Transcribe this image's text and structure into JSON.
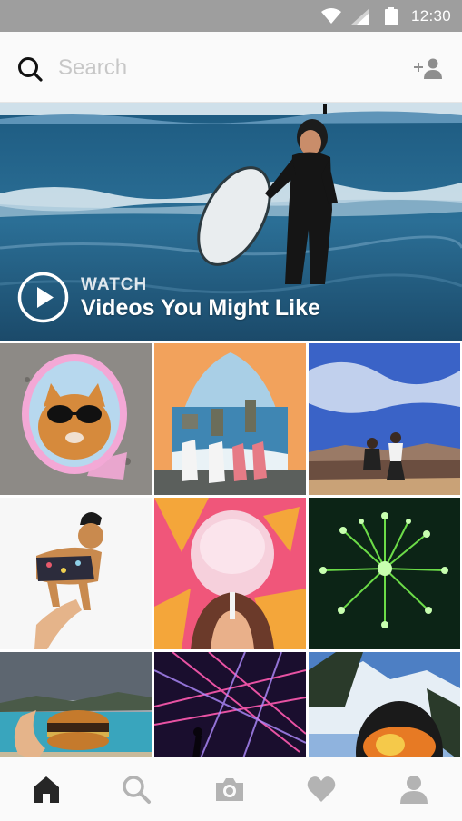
{
  "status_bar": {
    "time": "12:30",
    "icons": [
      "wifi-icon",
      "signal-icon",
      "battery-icon"
    ]
  },
  "search": {
    "placeholder": "Search",
    "value": ""
  },
  "hero": {
    "label": "WATCH",
    "title": "Videos You Might Like"
  },
  "grid": {
    "tiles": [
      "cat in sunglasses mirror",
      "tent view of sea stacks",
      "man kneeling at canyon",
      "dog in pirate hat",
      "cotton candy on star wall",
      "green fireworks",
      "burger at the beach",
      "concert laser lights",
      "skier with orange goggles"
    ]
  },
  "bottom_nav": {
    "items": [
      "home-icon",
      "search-icon",
      "camera-icon",
      "heart-icon",
      "profile-icon"
    ],
    "active": "home-icon",
    "active_color": "#262626",
    "inactive_color": "#b3b3b3"
  },
  "colors": {
    "status_bar": "#9e9e9e",
    "header_bg": "#fafafa",
    "placeholder": "#c7c7c7"
  }
}
